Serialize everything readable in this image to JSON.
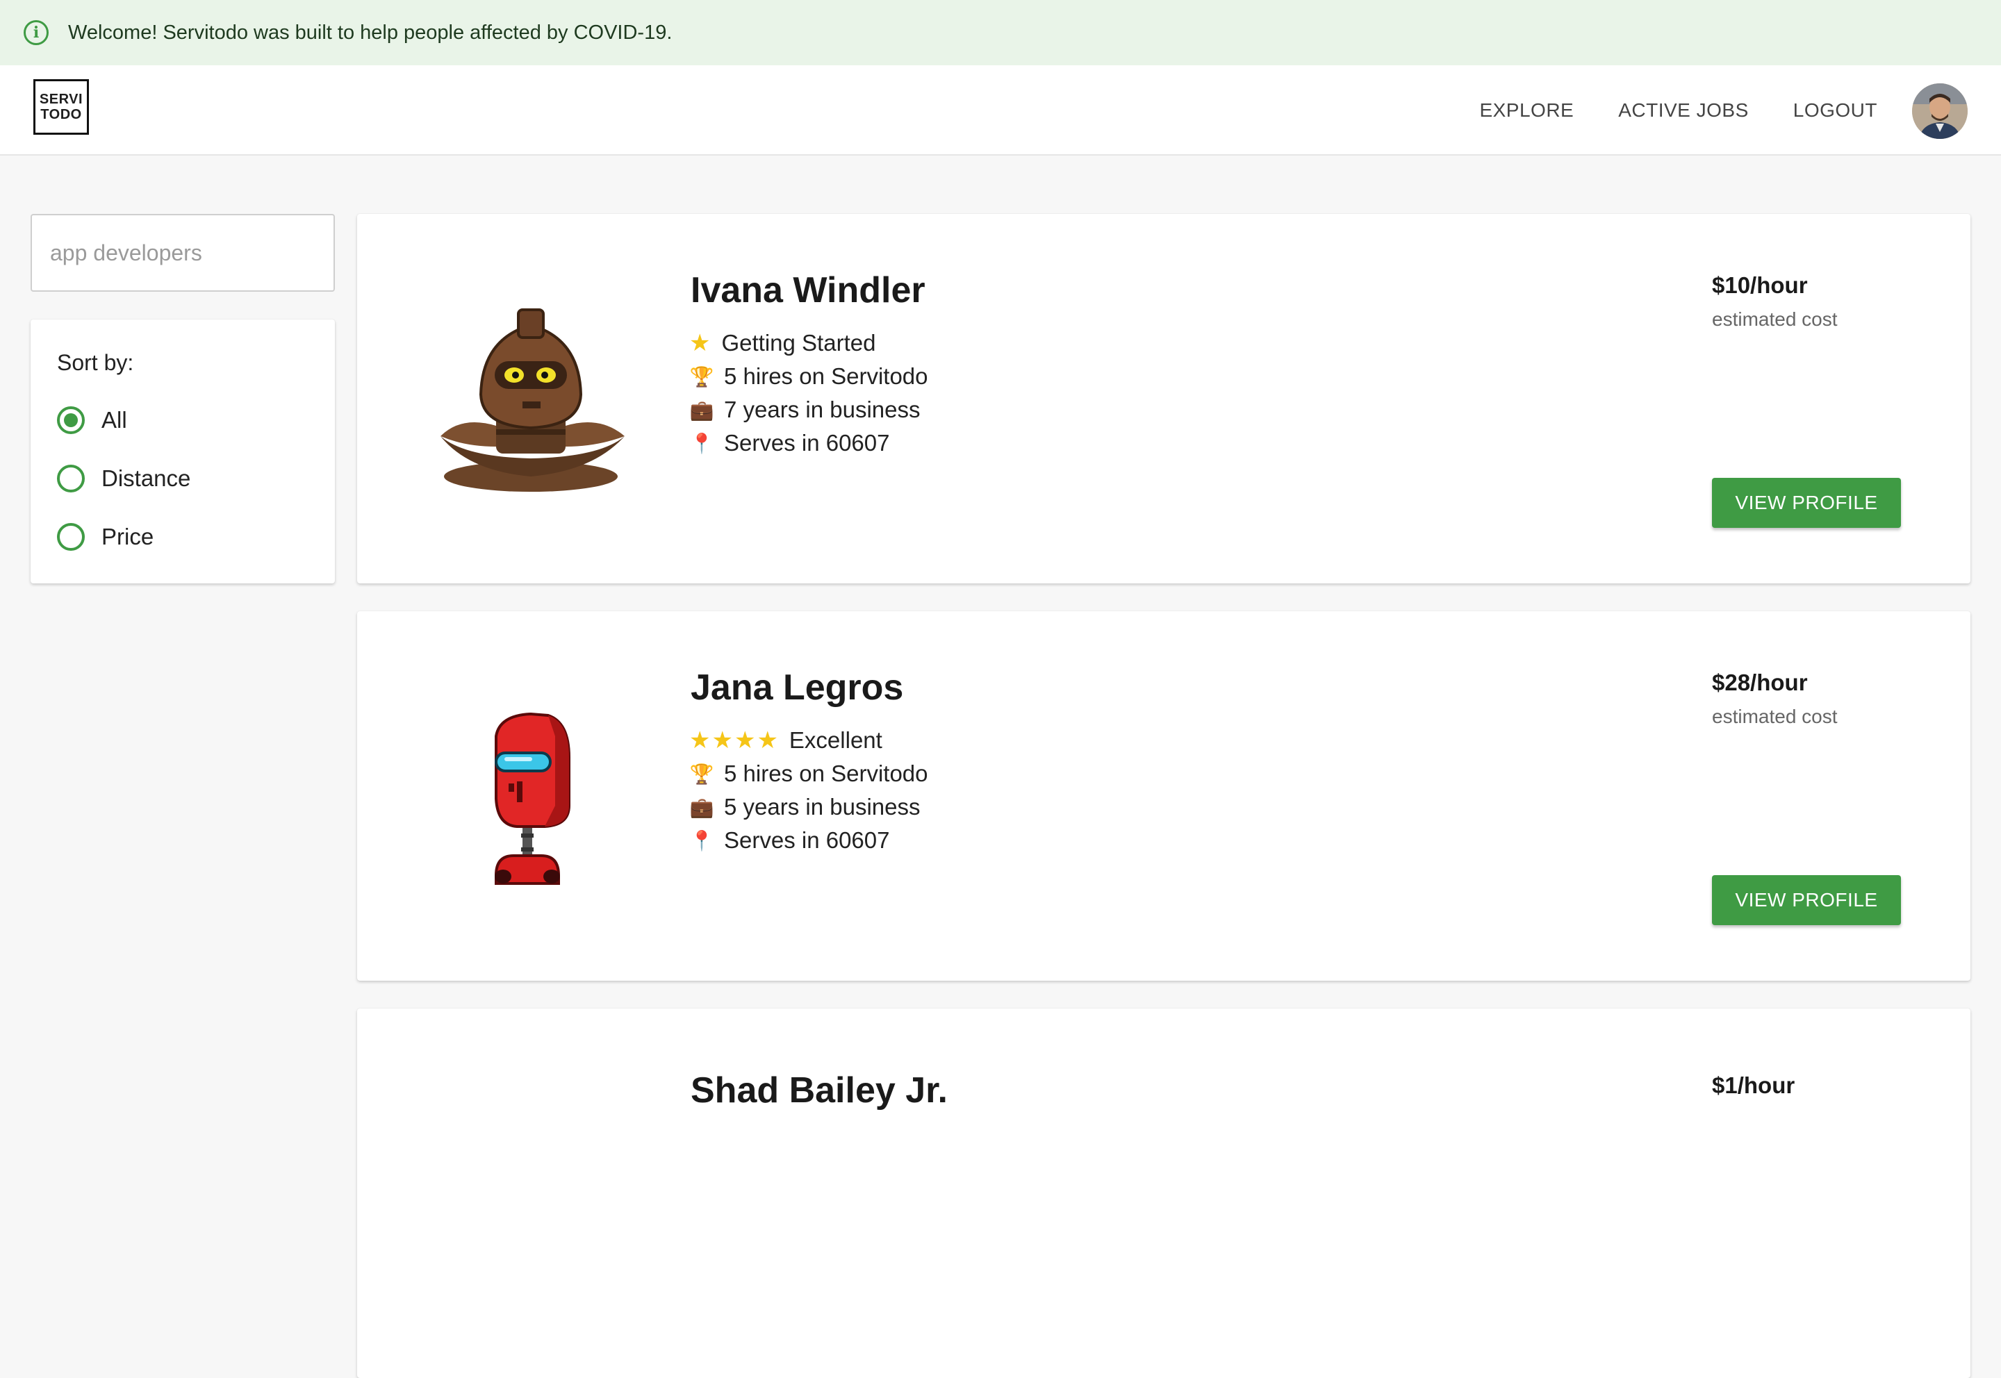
{
  "banner": {
    "text": "Welcome! Servitodo was built to help people affected by COVID-19.",
    "icon": "info-icon"
  },
  "header": {
    "logo_line1": "SERVI",
    "logo_line2": "TODO",
    "nav": [
      "EXPLORE",
      "ACTIVE JOBS",
      "LOGOUT"
    ]
  },
  "search": {
    "value": "",
    "placeholder": "app developers"
  },
  "sort": {
    "title": "Sort by:",
    "options": [
      "All",
      "Distance",
      "Price"
    ],
    "selected": "All"
  },
  "providers": [
    {
      "name": "Ivana Windler",
      "rating_stars": 1,
      "rating_label": "Getting Started",
      "hires": "5 hires on Servitodo",
      "years": "7 years in business",
      "serves": "Serves in 60607",
      "price": "$10/hour",
      "price_note": "estimated cost",
      "button": "VIEW PROFILE",
      "avatar": "brown-robot"
    },
    {
      "name": "Jana Legros",
      "rating_stars": 4,
      "rating_label": "Excellent",
      "hires": "5 hires on Servitodo",
      "years": "5 years in business",
      "serves": "Serves in 60607",
      "price": "$28/hour",
      "price_note": "estimated cost",
      "button": "VIEW PROFILE",
      "avatar": "red-robot"
    },
    {
      "name": "Shad Bailey Jr.",
      "price": "$1/hour"
    }
  ],
  "colors": {
    "accent": "#3f9b44",
    "banner_bg": "#e9f4e8",
    "page_bg": "#f7f7f7"
  }
}
